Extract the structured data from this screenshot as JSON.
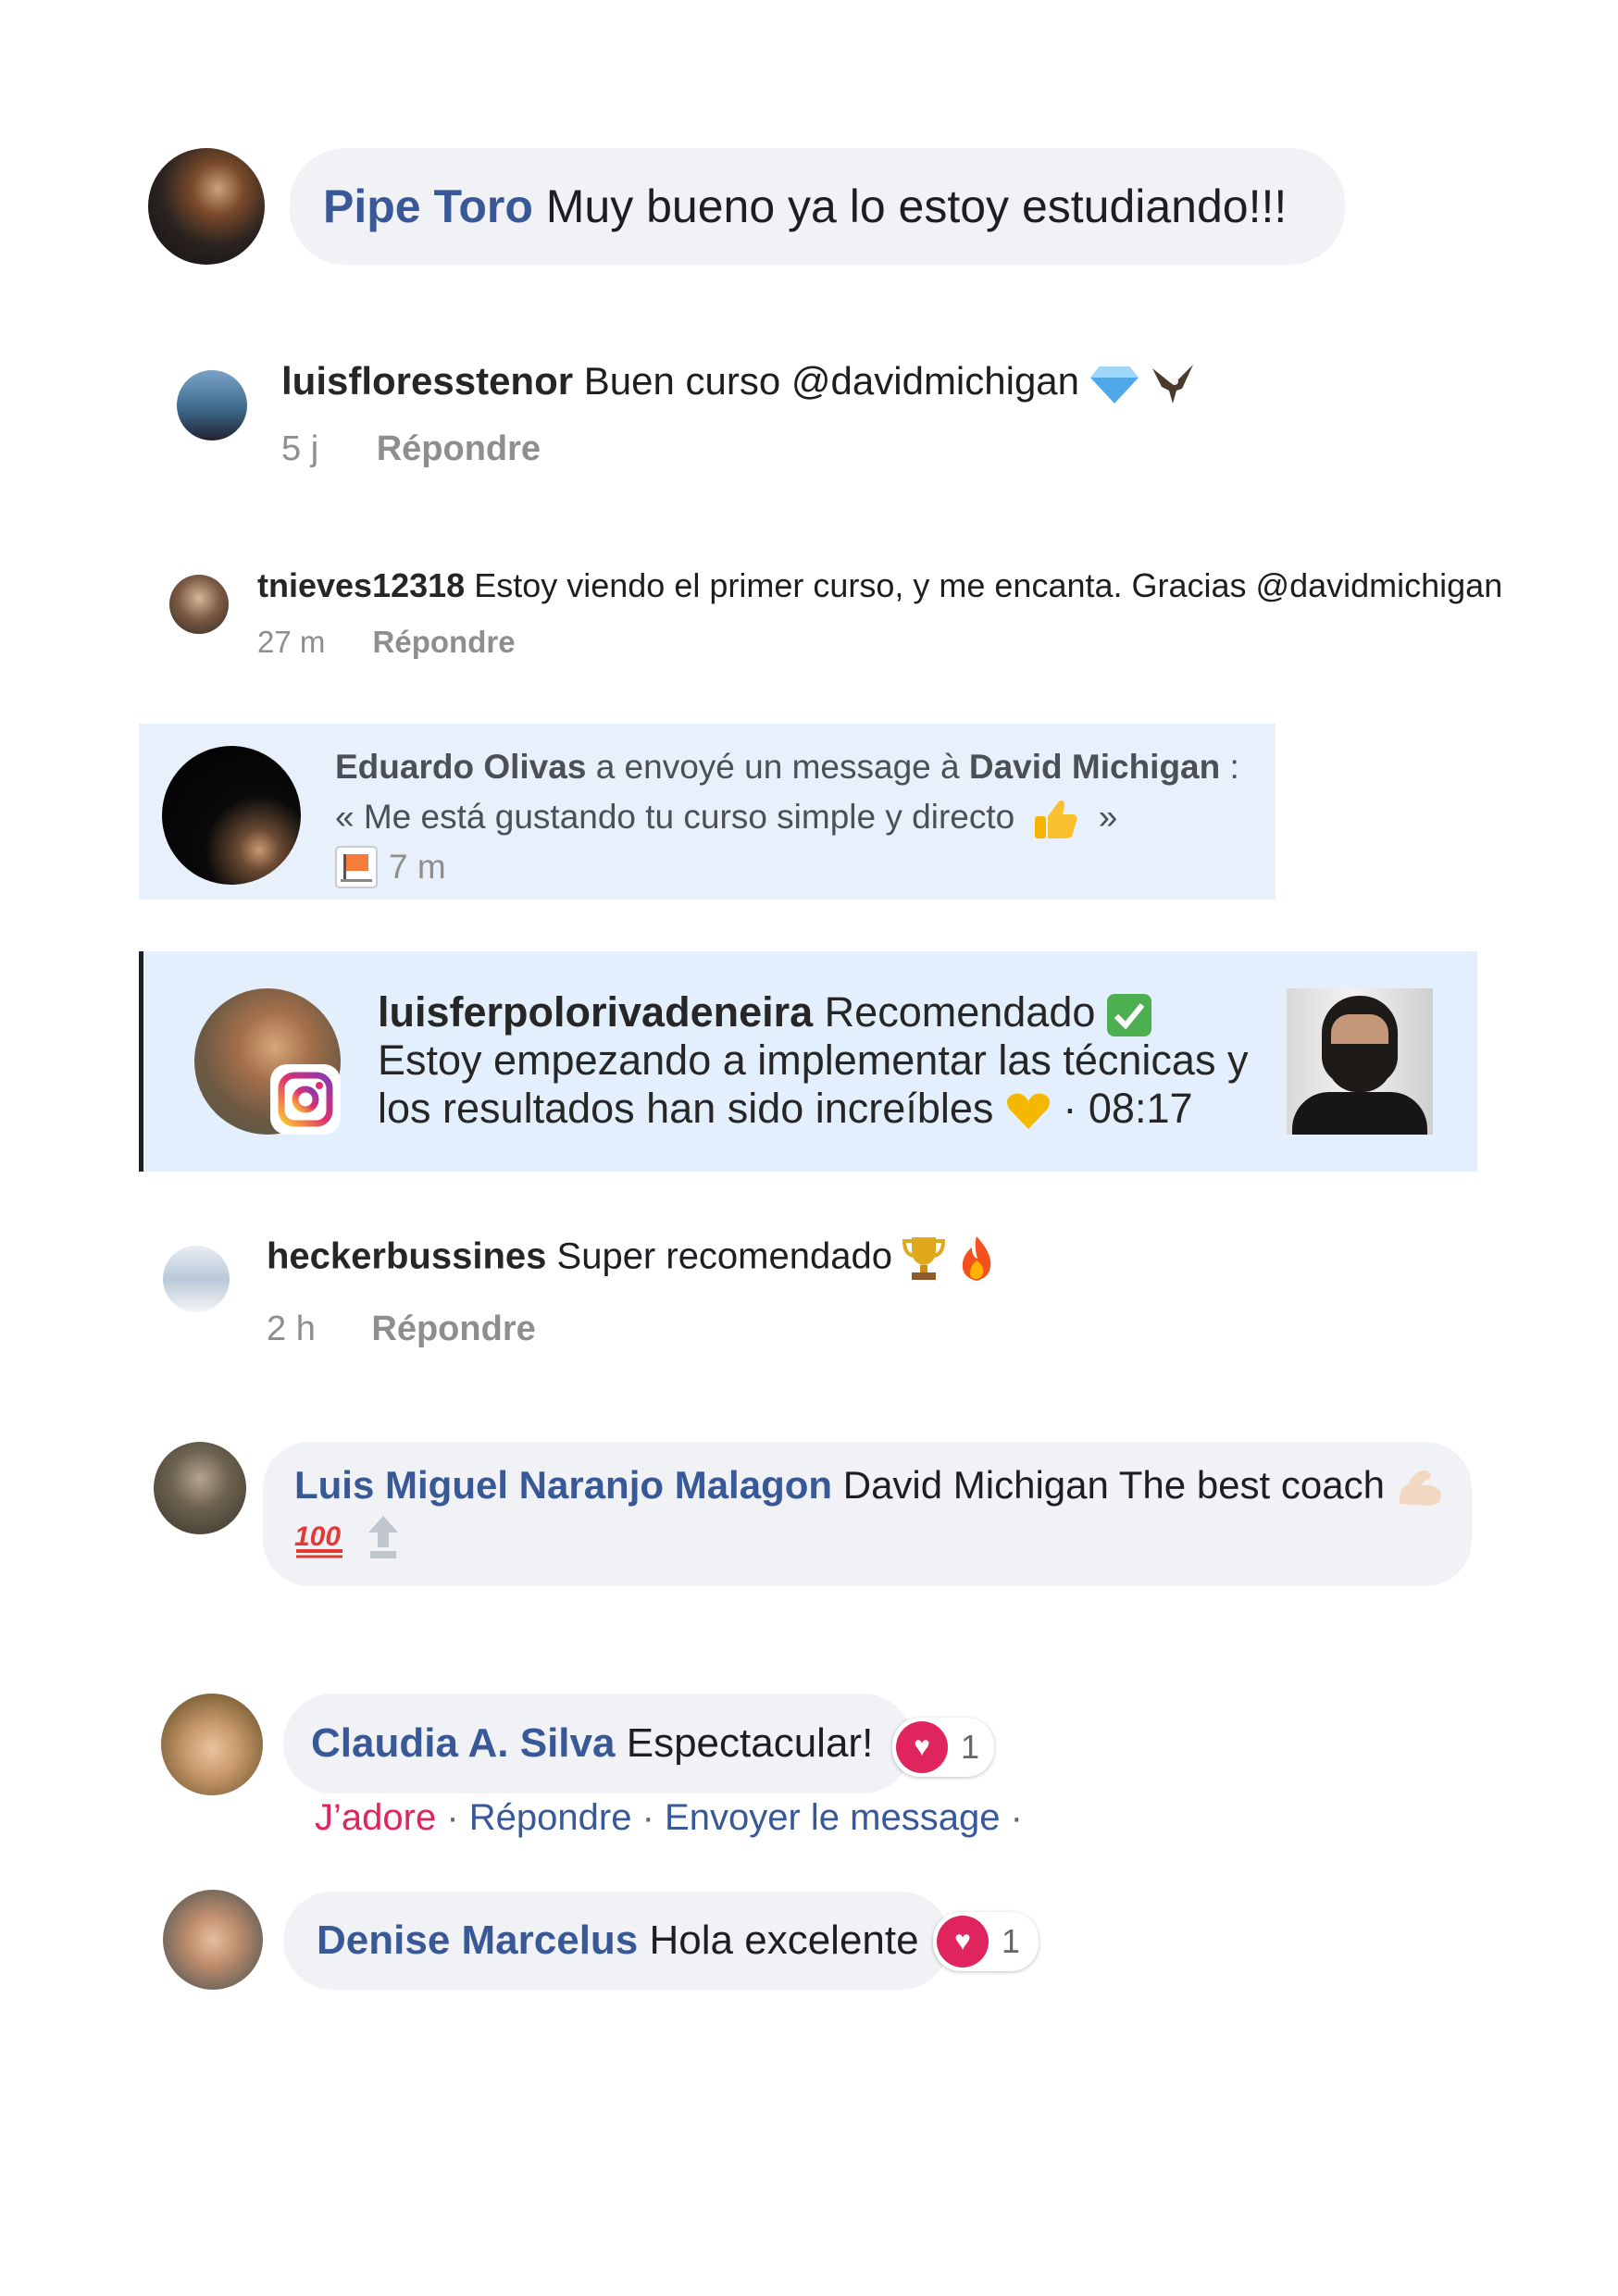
{
  "comments": [
    {
      "name": "Pipe Toro",
      "text": "Muy bueno ya lo estoy estudiando!!!"
    },
    {
      "name": "luisfloresstenor",
      "text": "Buen curso @davidmichigan",
      "time": "5 j",
      "reply": "Répondre"
    },
    {
      "name": "tnieves12318",
      "text": "Estoy viendo el primer curso, y me encanta. Gracias @davidmichigan",
      "time": "27 m",
      "reply": "Répondre"
    },
    {
      "name": "heckerbussines",
      "text": "Super recomendado",
      "time": "2 h",
      "reply": "Répondre"
    },
    {
      "name": "Luis Miguel Naranjo Malagon",
      "text": "David Michigan The best coach"
    },
    {
      "name": "Claudia A. Silva",
      "text": "Espectacular!",
      "reaction_count": "1",
      "like": "J’adore",
      "reply": "Répondre",
      "send": "Envoyer le message",
      "sep": "·"
    },
    {
      "name": "Denise Marcelus",
      "text": "Hola excelente",
      "reaction_count": "1"
    }
  ],
  "message_notification": {
    "sender": "Eduardo Olivas",
    "action": "a envoyé un message à",
    "recipient": "David Michigan",
    "colon": ":",
    "quote_open": "«",
    "quote": "Me está gustando tu curso simple y directo",
    "quote_close": "»",
    "time": "7 m"
  },
  "instagram_notification": {
    "name": "luisferpolorivadeneira",
    "text1": "Recomendado",
    "text2": "Estoy empezando a implementar las técnicas y los resultados han sido increíbles",
    "time": "· 08:17"
  },
  "icons": {
    "diamond": "gem-icon",
    "eagle": "eagle-icon",
    "thumbs": "thumbs-up-icon",
    "check": "check-mark-icon",
    "heart_yellow": "yellow-heart-icon",
    "trophy": "trophy-icon",
    "fire": "fire-icon",
    "muscle": "flexed-biceps-icon",
    "hundred": "hundred-points-icon",
    "top": "top-arrow-icon",
    "heart": "heart-reaction-icon",
    "instagram": "instagram-icon",
    "flag": "flag-icon"
  },
  "colors": {
    "fb_name": "#385898",
    "bubble": "#f0f2f5",
    "notification_bg": "#e7f0fb",
    "love": "#e0245e"
  }
}
